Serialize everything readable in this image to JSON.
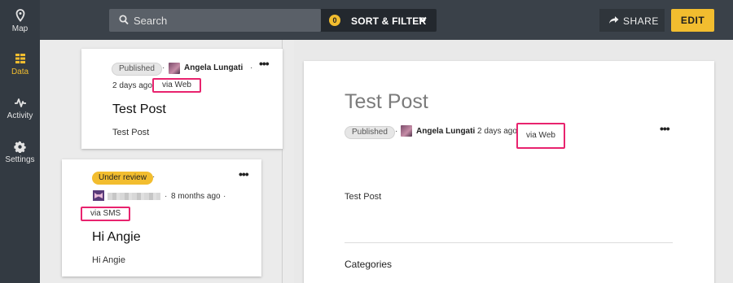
{
  "sidebar": {
    "items": [
      {
        "label": "Map",
        "icon": "map-pin-icon"
      },
      {
        "label": "Data",
        "icon": "data-list-icon"
      },
      {
        "label": "Activity",
        "icon": "activity-pulse-icon"
      },
      {
        "label": "Settings",
        "icon": "gear-icon"
      }
    ],
    "active": "Data"
  },
  "topbar": {
    "search_placeholder": "Search",
    "filter_count": "0",
    "sort_filter_label": "SORT & FILTER",
    "share_label": "SHARE",
    "edit_label": "EDIT"
  },
  "posts": [
    {
      "status": "Published",
      "author": "Angela Lungati",
      "time": "2 days ago",
      "source": "via Web",
      "title": "Test Post",
      "body": "Test Post"
    },
    {
      "status": "Under review",
      "time": "8 months ago",
      "source": "via SMS",
      "title": "Hi Angie",
      "body": "Hi Angie"
    }
  ],
  "detail": {
    "title": "Test Post",
    "status": "Published",
    "author": "Angela Lungati",
    "time": "2 days ago",
    "source": "via Web",
    "body": "Test Post",
    "section_heading": "Categories"
  },
  "colors": {
    "accent": "#f2bd2f",
    "highlight": "#e8236e",
    "sidebar_bg": "#333a42",
    "topbar_bg": "#3a4149"
  }
}
